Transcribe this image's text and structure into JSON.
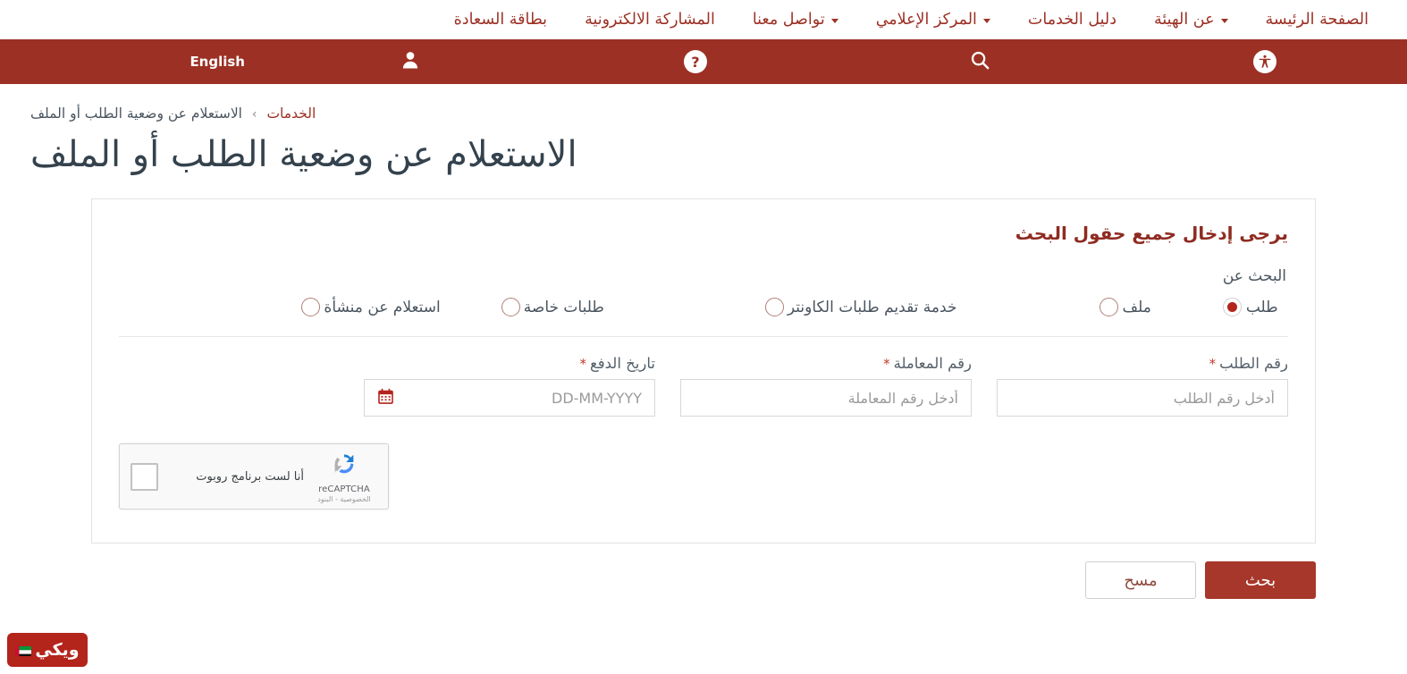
{
  "colors": {
    "brand_red": "#9c3024",
    "button_red": "#a6372a",
    "accent_red": "#b3241b",
    "heading_maroon": "#8f2b21",
    "title_gray": "#34424d",
    "text_gray": "#55606a"
  },
  "topnav": {
    "items": [
      {
        "label": "الصفحة الرئيسة",
        "has_caret": false
      },
      {
        "label": "عن الهيئة",
        "has_caret": true
      },
      {
        "label": "دليل الخدمات",
        "has_caret": false
      },
      {
        "label": "المركز الإعلامي",
        "has_caret": true
      },
      {
        "label": "تواصل معنا",
        "has_caret": true
      },
      {
        "label": "المشاركة الالكترونية",
        "has_caret": false
      },
      {
        "label": "بطاقة السعادة",
        "has_caret": false
      }
    ]
  },
  "utilbar": {
    "accessibility_icon": "accessibility-icon",
    "search_icon": "search-icon",
    "help_icon": "help-icon",
    "user_icon": "user-icon",
    "language_label": "English"
  },
  "breadcrumb": {
    "root": "الخدمات",
    "separator": "›",
    "current": "الاستعلام عن وضعية الطلب أو الملف"
  },
  "page": {
    "title": "الاستعلام عن وضعية الطلب أو الملف"
  },
  "form": {
    "heading": "يرجى إدخال جميع حقول البحث",
    "search_for_label": "البحث عن",
    "radio_options": [
      {
        "label": "طلب",
        "selected": true
      },
      {
        "label": "ملف",
        "selected": false
      },
      {
        "label": "خدمة تقديم طلبات الكاونتر",
        "selected": false
      },
      {
        "label": "طلبات خاصة",
        "selected": false
      },
      {
        "label": "استعلام عن منشأة",
        "selected": false
      }
    ],
    "fields": [
      {
        "label": "رقم الطلب",
        "required_mark": "*",
        "placeholder": "أدخل رقم الطلب",
        "value": "",
        "type": "text"
      },
      {
        "label": "رقم المعاملة",
        "required_mark": "*",
        "placeholder": "أدخل رقم المعاملة",
        "value": "",
        "type": "text"
      },
      {
        "label": "تاريخ الدفع",
        "required_mark": "*",
        "placeholder": "DD-MM-YYYY",
        "value": "",
        "type": "date",
        "icon": "calendar-icon"
      }
    ],
    "recaptcha": {
      "checkbox_label": "أنا لست برنامج روبوت",
      "brand_name": "reCAPTCHA",
      "links": "الخصوصية - البنود"
    },
    "buttons": {
      "submit": "بحث",
      "clear": "مسح"
    }
  },
  "watermark": {
    "text": "ويكي"
  }
}
